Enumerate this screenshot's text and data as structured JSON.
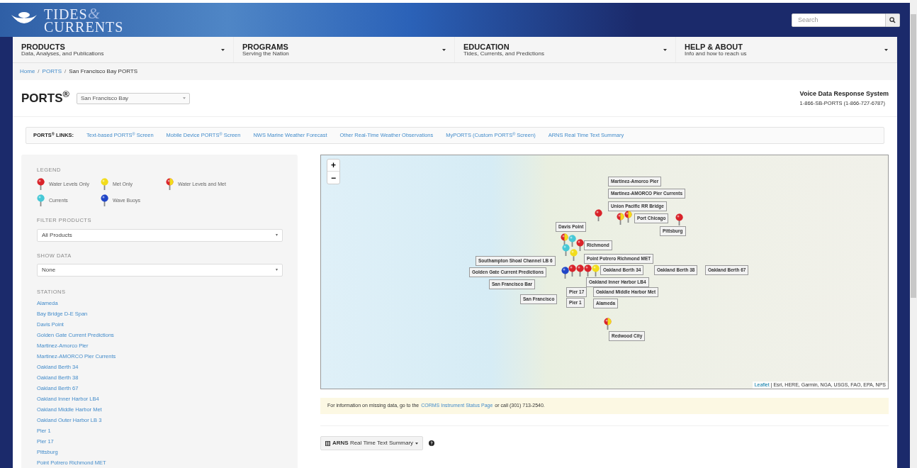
{
  "header": {
    "logo": {
      "line1": "TIDES",
      "ampersand": "&",
      "line2": "CURRENTS"
    },
    "search": {
      "placeholder": "Search"
    }
  },
  "nav": [
    {
      "title": "PRODUCTS",
      "subtitle": "Data, Analyses, and Publications"
    },
    {
      "title": "PROGRAMS",
      "subtitle": "Serving the Nation"
    },
    {
      "title": "EDUCATION",
      "subtitle": "Tides, Currents, and Predictions"
    },
    {
      "title": "HELP & ABOUT",
      "subtitle": "Info and how to reach us"
    }
  ],
  "breadcrumb_separator": "/",
  "breadcrumb": [
    {
      "label": "Home"
    },
    {
      "label": "PORTS"
    },
    {
      "label": "San Francisco Bay PORTS"
    }
  ],
  "heading": {
    "title": "PORTS$^{®}$",
    "region_select": "San Francisco Bay",
    "voice_title": "Voice Data Response System",
    "voice_phone": "1-866-SB-PORTS (1-866-727-6787)"
  },
  "links": {
    "label": "PORTS$^{®}$ LINKS:",
    "items": [
      "Text-based PORTS$^{®}$ Screen",
      "Mobile Device PORTS$^{®}$ Screen",
      "NWS Marine Weather Forecast",
      "Other Real-Time Weather Observations",
      "MyPORTS (Custom PORTS$^{®}$ Screen)",
      "ARNS Real Time Text Summary"
    ]
  },
  "legend": {
    "title": "LEGEND",
    "items": [
      {
        "label": "Water Levels Only",
        "kind": "water"
      },
      {
        "label": "Met Only",
        "kind": "met"
      },
      {
        "label": "Water Levels and Met",
        "kind": "both"
      },
      {
        "label": "Currents",
        "kind": "currents"
      },
      {
        "label": "Wave Buoys",
        "kind": "waves"
      }
    ]
  },
  "filters": [
    {
      "label": "FILTER PRODUCTS",
      "value": "All Products"
    },
    {
      "label": "SHOW DATA",
      "value": "None"
    }
  ],
  "stations": {
    "title": "STATIONS",
    "items": [
      "Alameda",
      "Bay Bridge D-E Span",
      "Davis Point",
      "Golden Gate Current Predictions",
      "Martinez-Amorco Pier",
      "Martinez-AMORCO Pier Currents",
      "Oakland Berth 34",
      "Oakland Berth 38",
      "Oakland Berth 67",
      "Oakland Inner Harbor LB4",
      "Oakland Middle Harbor Met",
      "Oakland Outer Harbor LB 3",
      "Pier 1",
      "Pier 17",
      "Pittsburg",
      "Point Potrero Richmond MET"
    ]
  },
  "map": {
    "zoom_in": "+",
    "zoom_out": "−",
    "labels": [
      "Martinez-Amorco Pier",
      "Martinez-AMORCO Pier Currents",
      "Union Pacific RR Bridge",
      "Port Chicago",
      "Pittsburg",
      "Davis Point",
      "Richmond",
      "Point Potrero Richmond MET",
      "Southampton Shoal Channel LB 6",
      "Golden Gate Current Predictions",
      "San Francisco Bar",
      "Oakland Berth 34",
      "Oakland Berth 38",
      "Oakland Berth 67",
      "Oakland Inner Harbor LB4",
      "Pier 17",
      "Oakland Middle Harbor Met",
      "San Francisco",
      "Pier 1",
      "Alameda",
      "Redwood City"
    ],
    "pins": [
      {
        "kind": "water"
      },
      {
        "kind": "both"
      },
      {
        "kind": "both"
      },
      {
        "kind": "water"
      },
      {
        "kind": "both"
      },
      {
        "kind": "currents"
      },
      {
        "kind": "water"
      },
      {
        "kind": "currents"
      },
      {
        "kind": "met"
      },
      {
        "kind": "waves"
      },
      {
        "kind": "water"
      },
      {
        "kind": "water"
      },
      {
        "kind": "water"
      },
      {
        "kind": "met"
      },
      {
        "kind": "both"
      }
    ],
    "attribution_link": "Leaflet",
    "attribution": "| Esri, HERE, Garmin, NGA, USGS, FAO, EPA, NPS"
  },
  "notice": {
    "before": "For information on missing data, go to the",
    "link": "CORMS Instrument Status Page",
    "after": "or call (301) 713-2540."
  },
  "summary_button": "**ARNS** Real Time Text Summary"
}
